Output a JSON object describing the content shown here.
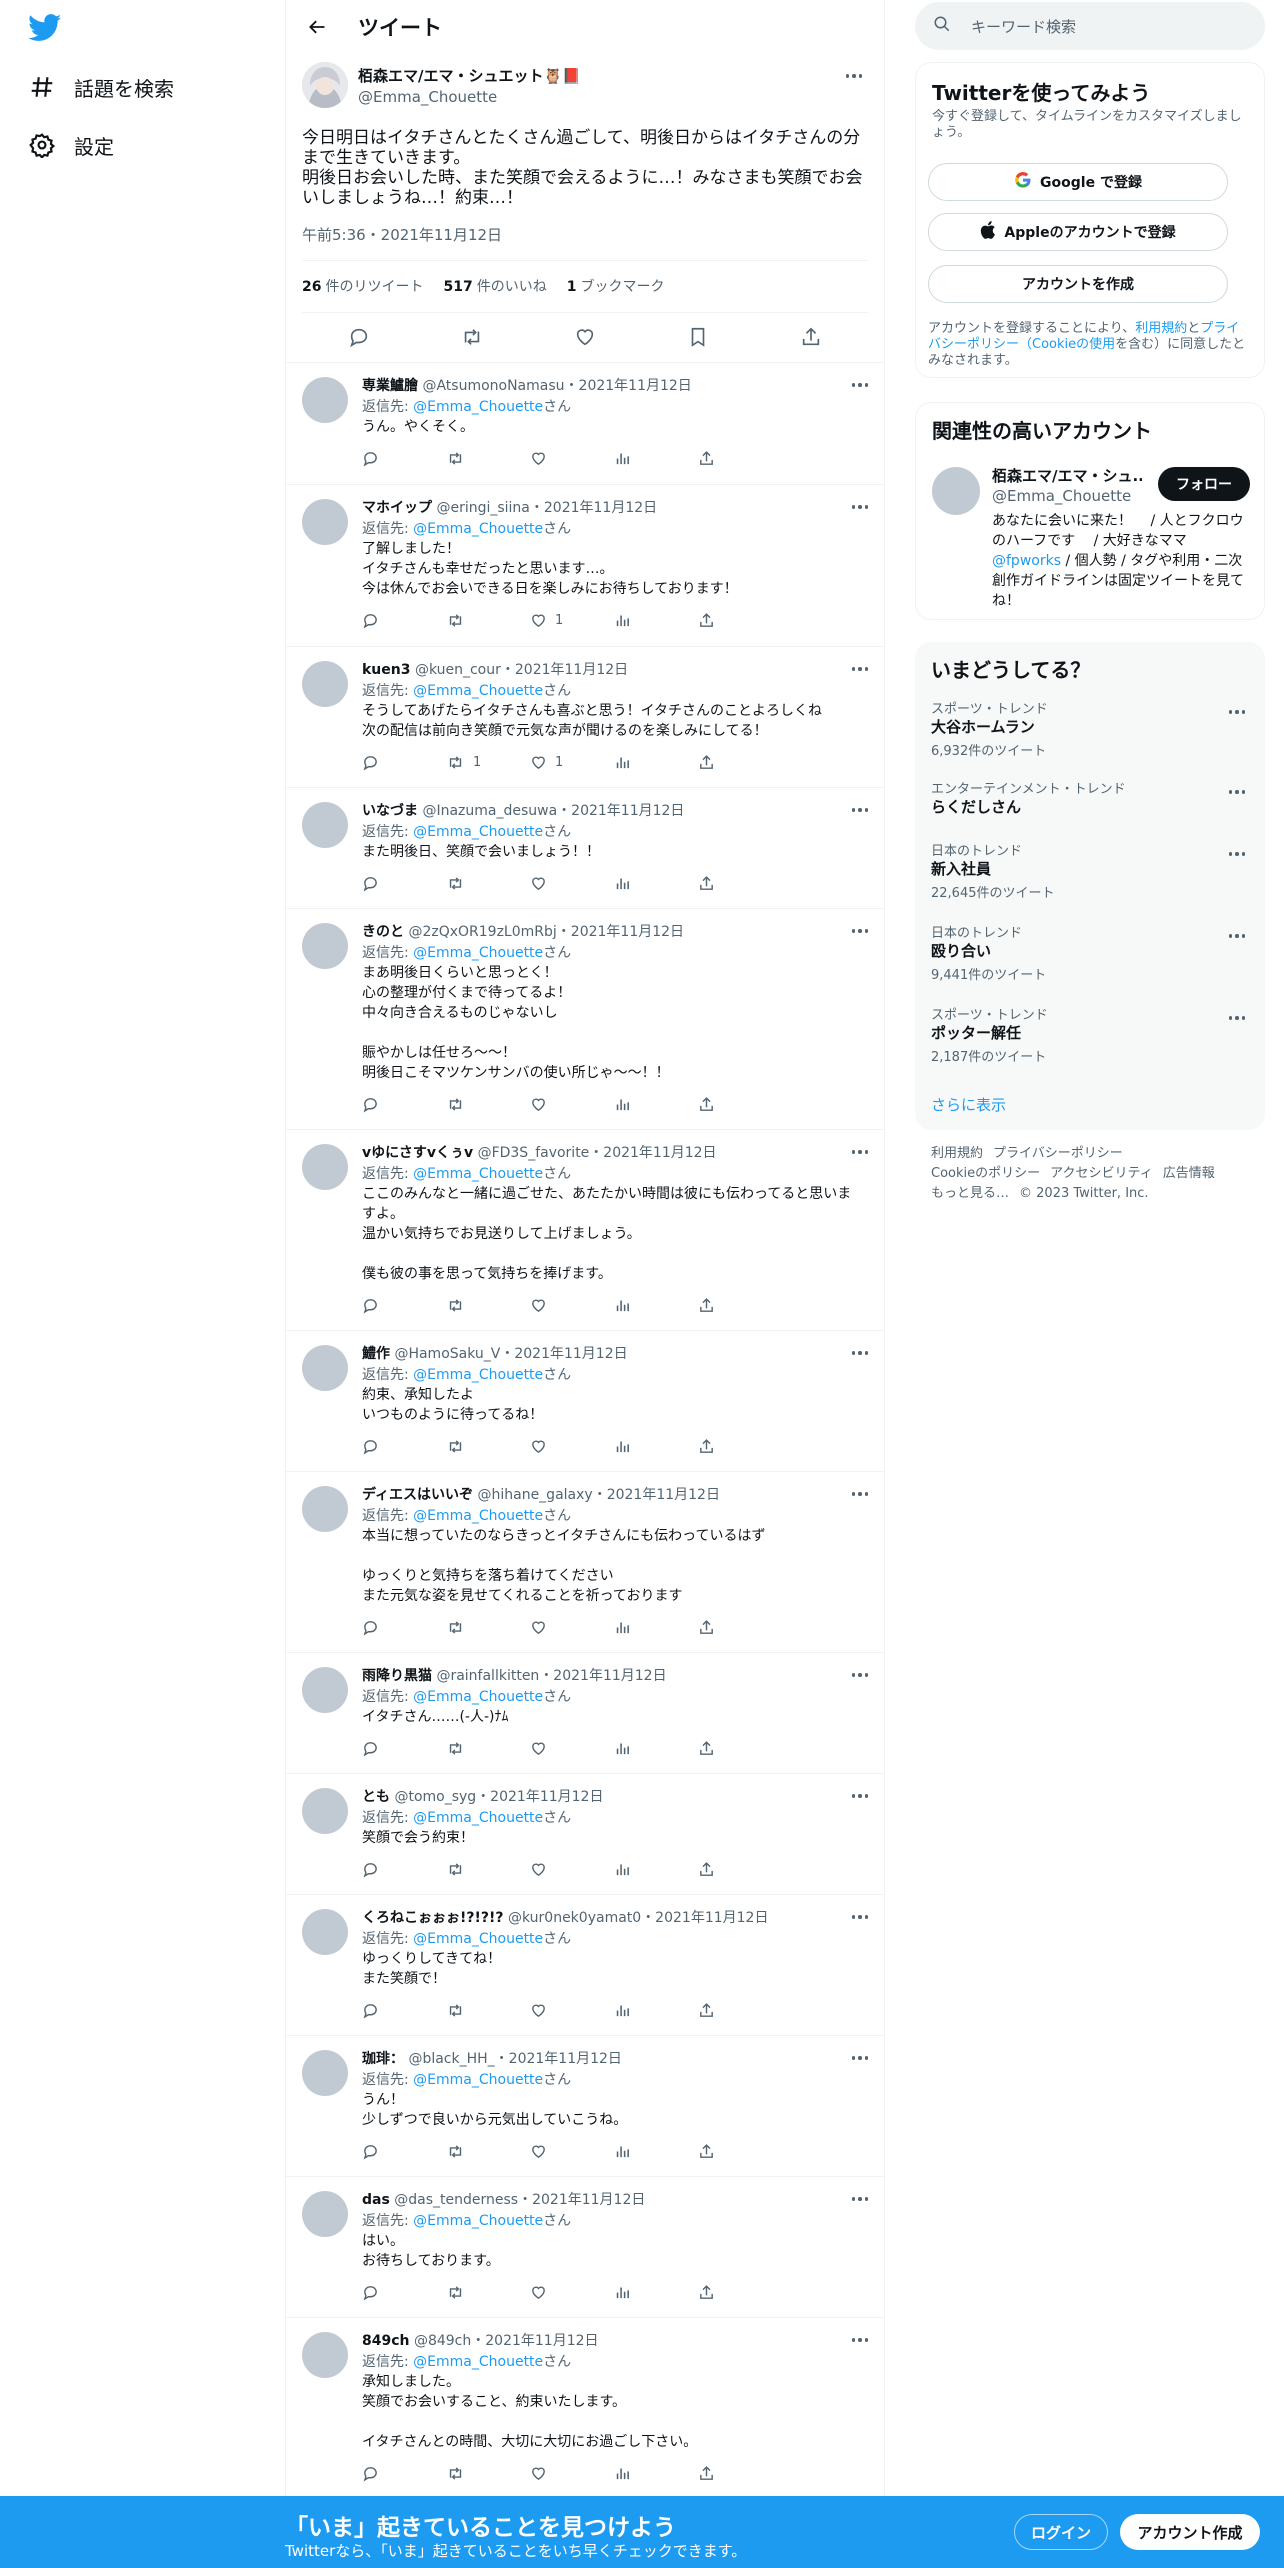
{
  "nav": {
    "search_topics": "話題を検索",
    "settings": "設定"
  },
  "header": {
    "title": "ツイート"
  },
  "main_tweet": {
    "name": "栢森エマ/エマ・シュエット🦉📕",
    "handle": "@Emma_Chouette",
    "text": "今日明日はイタチさんとたくさん過ごして、明後日からはイタチさんの分まで生きていきます。\n明後日お会いした時、また笑顔で会えるように…！みなさまも笑顔でお会いしましょうね…！約束…！",
    "timestamp": "午前5:36・2021年11月12日",
    "retweets": "26",
    "retweets_label": "件のリツイート",
    "likes": "517",
    "likes_label": "件のいいね",
    "bookmarks": "1",
    "bookmarks_label": "ブックマーク"
  },
  "reply_prefix": "返信先: ",
  "reply_to": "@Emma_Chouette",
  "reply_suffix": "さん",
  "replies": [
    {
      "name": "専業鱸膾",
      "handle": "@AtsumonoNamasu",
      "date": "・2021年11月12日",
      "text": "うん。やくそく。",
      "retweets": "",
      "likes": ""
    },
    {
      "name": "マホイップ",
      "handle": "@eringi_siina",
      "date": "・2021年11月12日",
      "text": "了解しました！\nイタチさんも幸せだったと思います…。\n今は休んでお会いできる日を楽しみにお待ちしております！",
      "retweets": "",
      "likes": "1"
    },
    {
      "name": "kuen3",
      "handle": "@kuen_cour",
      "date": "・2021年11月12日",
      "text": "そうしてあげたらイタチさんも喜ぶと思う！イタチさんのことよろしくね\n次の配信は前向き笑顔で元気な声が聞けるのを楽しみにしてる！",
      "retweets": "1",
      "likes": "1"
    },
    {
      "name": "いなづま",
      "handle": "@Inazuma_desuwa",
      "date": "・2021年11月12日",
      "text": "また明後日、笑顔で会いましょう！！",
      "retweets": "",
      "likes": ""
    },
    {
      "name": "きのと",
      "handle": "@2zQxOR19zL0mRbj",
      "date": "・2021年11月12日",
      "text": "まあ明後日くらいと思っとく！\n心の整理が付くまで待ってるよ！\n中々向き合えるものじゃないし\n\n賑やかしは任せろ〜〜！\n明後日こそマツケンサンバの使い所じゃ〜〜！！",
      "retweets": "",
      "likes": ""
    },
    {
      "name": "vゆにさすvくぅv",
      "handle": "@FD3S_favorite",
      "date": "・2021年11月12日",
      "text": "ここのみんなと一緒に過ごせた、あたたかい時間は彼にも伝わってると思いますよ。\n温かい気持ちでお見送りして上げましょう。\n\n僕も彼の事を思って気持ちを捧げます。",
      "retweets": "",
      "likes": ""
    },
    {
      "name": "鱧作",
      "handle": "@HamoSaku_V",
      "date": "・2021年11月12日",
      "text": "約束、承知したよ\nいつものように待ってるね！",
      "retweets": "",
      "likes": ""
    },
    {
      "name": "ディエスはいいぞ",
      "handle": "@hihane_galaxy",
      "date": "・2021年11月12日",
      "text": "本当に想っていたのならきっとイタチさんにも伝わっているはず\n\nゆっくりと気持ちを落ち着けてください\nまた元気な姿を見せてくれることを祈っております",
      "retweets": "",
      "likes": ""
    },
    {
      "name": "雨降り黒猫",
      "handle": "@rainfallkitten",
      "date": "・2021年11月12日",
      "text": "イタチさん……(-人-)ﾅﾑ",
      "retweets": "",
      "likes": ""
    },
    {
      "name": "とも",
      "handle": "@tomo_syg",
      "date": "・2021年11月12日",
      "text": "笑顔で会う約束！",
      "retweets": "",
      "likes": ""
    },
    {
      "name": "くろねこぉぉぉ!?!?!?",
      "handle": "@kur0nek0yamat0",
      "date": "・2021年11月12日",
      "text": "ゆっくりしてきてね！\nまた笑顔で！",
      "retweets": "",
      "likes": ""
    },
    {
      "name": "珈琲：",
      "handle": "@black_HH_",
      "date": "・2021年11月12日",
      "text": "うん！\n少しずつで良いから元気出していこうね。",
      "retweets": "",
      "likes": ""
    },
    {
      "name": "das",
      "handle": "@das_tenderness",
      "date": "・2021年11月12日",
      "text": "はい。\nお待ちしております。",
      "retweets": "",
      "likes": ""
    },
    {
      "name": "849ch",
      "handle": "@849ch",
      "date": "・2021年11月12日",
      "text": "承知しました。\n笑顔でお会いすること、約束いたします。\n\nイタチさんとの時間、大切に大切にお過ごし下さい。",
      "retweets": "",
      "likes": ""
    }
  ],
  "search": {
    "placeholder": "キーワード検索"
  },
  "signup_panel": {
    "title": "Twitterを使ってみよう",
    "subtitle": "今すぐ登録して、タイムラインをカスタマイズしましょう。",
    "google": "Google で登録",
    "apple": "Appleのアカウントで登録",
    "create": "アカウントを作成",
    "legal_pre": "アカウントを登録することにより、",
    "legal_terms": "利用規約",
    "legal_and": "と",
    "legal_privacy": "プライバシーポリシー（Cookieの使用",
    "legal_post": "を含む）に同意したとみなされます。"
  },
  "related": {
    "title": "関連性の高いアカウント",
    "name": "栢森エマ/エマ・シュ...",
    "handle": "@Emma_Chouette",
    "follow": "フォロー",
    "bio1": "あなたに会いに来た！　 / 人とフクロウのハーフです　 / 大好きなママ",
    "bio_link": "@fpworks",
    "bio2": " / 個人勢 / タグや利用・二次創作ガイドラインは固定ツイートを見てね！"
  },
  "trends": {
    "title": "いまどうしてる？",
    "items": [
      {
        "category": "スポーツ・トレンド",
        "name": "大谷ホームラン",
        "count": "6,932件のツイート"
      },
      {
        "category": "エンターテインメント・トレンド",
        "name": "らくだしさん",
        "count": ""
      },
      {
        "category": "日本のトレンド",
        "name": "新入社員",
        "count": "22,645件のツイート"
      },
      {
        "category": "日本のトレンド",
        "name": "殴り合い",
        "count": "9,441件のツイート"
      },
      {
        "category": "スポーツ・トレンド",
        "name": "ポッター解任",
        "count": "2,187件のツイート"
      }
    ],
    "show_more": "さらに表示"
  },
  "footer": {
    "terms": "利用規約",
    "privacy": "プライバシーポリシー",
    "cookie": "Cookieのポリシー",
    "access": "アクセシビリティ",
    "ads": "広告情報",
    "more": "もっと見る…",
    "copy": "© 2023 Twitter, Inc."
  },
  "bottom_bar": {
    "title": "「いま」起きていることを見つけよう",
    "subtitle": "Twitterなら、「いま」起きていることをいち早くチェックできます。",
    "login": "ログイン",
    "signup": "アカウント作成"
  },
  "colors": {
    "accent": "#1d9bf0",
    "text": "#0f1419",
    "muted": "#536471"
  }
}
